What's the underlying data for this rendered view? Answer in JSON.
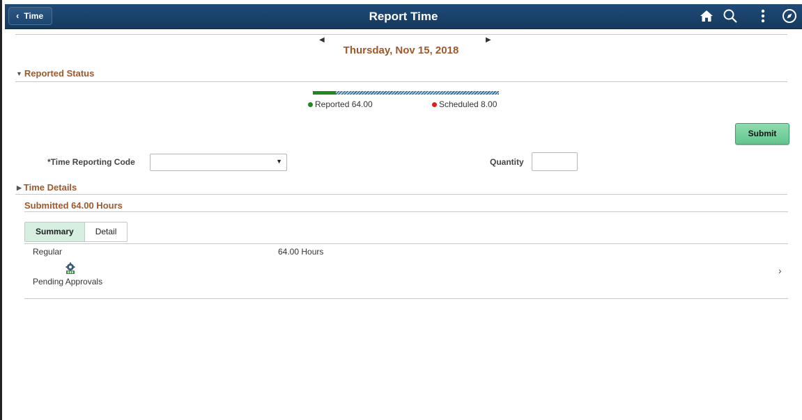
{
  "header": {
    "back_label": "Time",
    "title": "Report Time",
    "icons": [
      "home-icon",
      "search-icon",
      "more-options-icon",
      "navbar-compass-icon"
    ]
  },
  "date_nav": {
    "date": "Thursday, Nov 15, 2018"
  },
  "reported_status": {
    "title": "Reported Status",
    "reported_label": "Reported 64.00",
    "scheduled_label": "Scheduled 8.00",
    "reported_fraction": 0.125,
    "colors": {
      "reported": "#1e8a1e",
      "scheduled": "#e81919",
      "bar_stripe": "#2b6b98"
    }
  },
  "actions": {
    "submit_label": "Submit"
  },
  "form": {
    "trc_label": "*Time Reporting Code",
    "trc_value": "",
    "quantity_label": "Quantity",
    "quantity_value": ""
  },
  "time_details": {
    "title": "Time Details"
  },
  "submitted": {
    "title": "Submitted 64.00 Hours",
    "tabs": [
      {
        "label": "Summary",
        "active": true
      },
      {
        "label": "Detail",
        "active": false
      }
    ],
    "rows": [
      {
        "type": "Regular",
        "hours": "64.00 Hours",
        "status": "Pending Approvals",
        "status_icon": "pending-approval-icon"
      }
    ]
  },
  "colors": {
    "header_bg": "#1a4269",
    "section_title": "#a0582a",
    "submit_bg": "#7ad2a0"
  }
}
